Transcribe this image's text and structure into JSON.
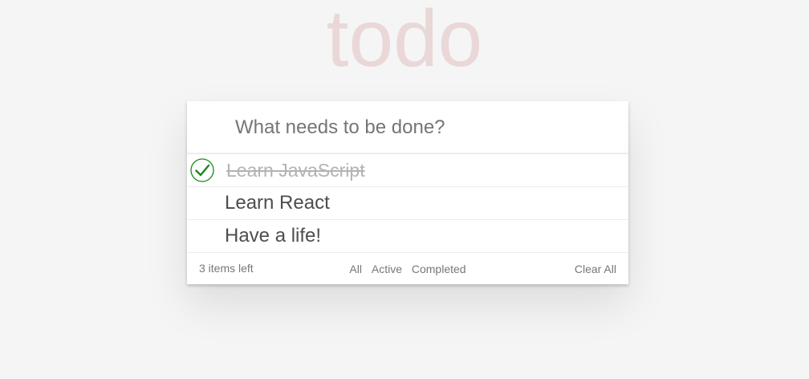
{
  "header": {
    "title": "todo"
  },
  "new_todo": {
    "placeholder": "What needs to be done?",
    "value": ""
  },
  "todos": [
    {
      "label": "Learn JavaScript",
      "completed": true
    },
    {
      "label": "Learn React",
      "completed": false
    },
    {
      "label": "Have a life!",
      "completed": false
    }
  ],
  "footer": {
    "count_text": "3 items left",
    "filters": [
      {
        "label": "All"
      },
      {
        "label": "Active"
      },
      {
        "label": "Completed"
      }
    ],
    "clear_label": "Clear All"
  },
  "colors": {
    "title": "#ead7d7",
    "check": "#1a8a1a",
    "completed_text": "#b3b3b3"
  }
}
